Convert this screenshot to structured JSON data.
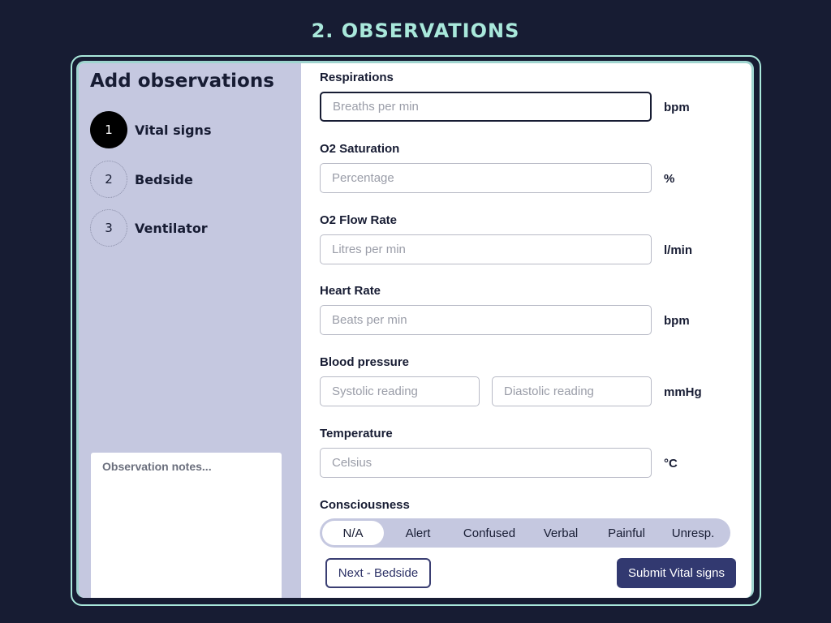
{
  "page_title": "2. OBSERVATIONS",
  "sidebar": {
    "title": "Add observations",
    "steps": [
      {
        "number": "1",
        "label": "Vital signs"
      },
      {
        "number": "2",
        "label": "Bedside"
      },
      {
        "number": "3",
        "label": "Ventilator"
      }
    ],
    "notes_placeholder": "Observation notes..."
  },
  "form": {
    "respirations": {
      "label": "Respirations",
      "placeholder": "Breaths per min",
      "unit": "bpm"
    },
    "o2_saturation": {
      "label": "O2 Saturation",
      "placeholder": "Percentage",
      "unit": "%"
    },
    "o2_flow_rate": {
      "label": "O2 Flow Rate",
      "placeholder": "Litres per min",
      "unit": "l/min"
    },
    "heart_rate": {
      "label": "Heart Rate",
      "placeholder": "Beats per min",
      "unit": "bpm"
    },
    "blood_pressure": {
      "label": "Blood pressure",
      "systolic_placeholder": "Systolic reading",
      "diastolic_placeholder": "Diastolic reading",
      "unit": "mmHg"
    },
    "temperature": {
      "label": "Temperature",
      "placeholder": "Celsius",
      "unit": "°C"
    },
    "consciousness": {
      "label": "Consciousness",
      "options": [
        "N/A",
        "Alert",
        "Confused",
        "Verbal",
        "Painful",
        "Unresp."
      ],
      "selected": "N/A"
    }
  },
  "actions": {
    "next_label": "Next - Bedside",
    "submit_label": "Submit Vital signs"
  },
  "colors": {
    "background": "#171c33",
    "accent": "#a9e8db",
    "sidebar": "#c5c8e0",
    "primary_button": "#323970"
  }
}
